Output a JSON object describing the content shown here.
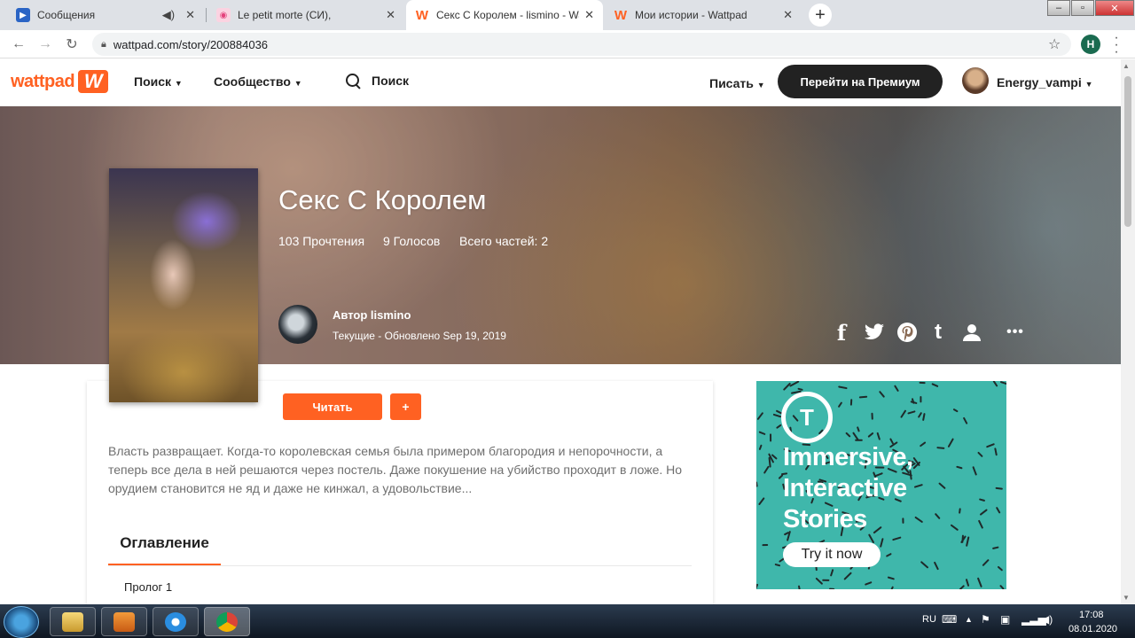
{
  "browser": {
    "tabs": [
      {
        "title": "Сообщения",
        "icon": "video-favicon",
        "color": "#2a64c5"
      },
      {
        "title": "Le petit morte (СИ),",
        "icon": "pig-favicon",
        "color": "#e4427c"
      },
      {
        "title": "Секс С Королем - lismino - Watt",
        "icon": "wattpad-favicon",
        "color": "#ff6122"
      },
      {
        "title": "Мои истории - Wattpad",
        "icon": "wattpad-favicon",
        "color": "#ff6122"
      }
    ],
    "url": "wattpad.com/story/200884036",
    "profile_initial": "H"
  },
  "header": {
    "logo_text": "wattpad",
    "logo_mark": "W",
    "nav_search": "Поиск",
    "nav_community": "Сообщество",
    "search_label": "Поиск",
    "write": "Писать",
    "premium": "Перейти на Премиум",
    "username": "Energy_vampi"
  },
  "story": {
    "title": "Секс С Королем",
    "reads": "103 Прочтения",
    "votes": "9 Голосов",
    "parts": "Всего частей: 2",
    "author": "Автор lismino",
    "status": "Текущие - Обновлено Sep 19, 2019",
    "read_button": "Читать",
    "add_button": "+",
    "description": "Власть развращает. Когда-то королевская семья была примером благородия и непорочности, а теперь все дела в ней решаются через постель. Даже покушение на убийство проходит в ложе. Но орудием становится не яд и даже не кинжал, а удовольствие...",
    "toc_label": "Оглавление",
    "chapters": [
      "Пролог 1"
    ]
  },
  "share": [
    "f",
    "t",
    "p",
    "t",
    "u",
    "•••"
  ],
  "ad": {
    "logo": "T",
    "line1": "Immersive,",
    "line2": "Interactive",
    "line3": "Stories",
    "cta": "Try it now",
    "color": "#3fb7ab"
  },
  "taskbar": {
    "lang": "RU",
    "time": "17:08",
    "date": "08.01.2020"
  }
}
